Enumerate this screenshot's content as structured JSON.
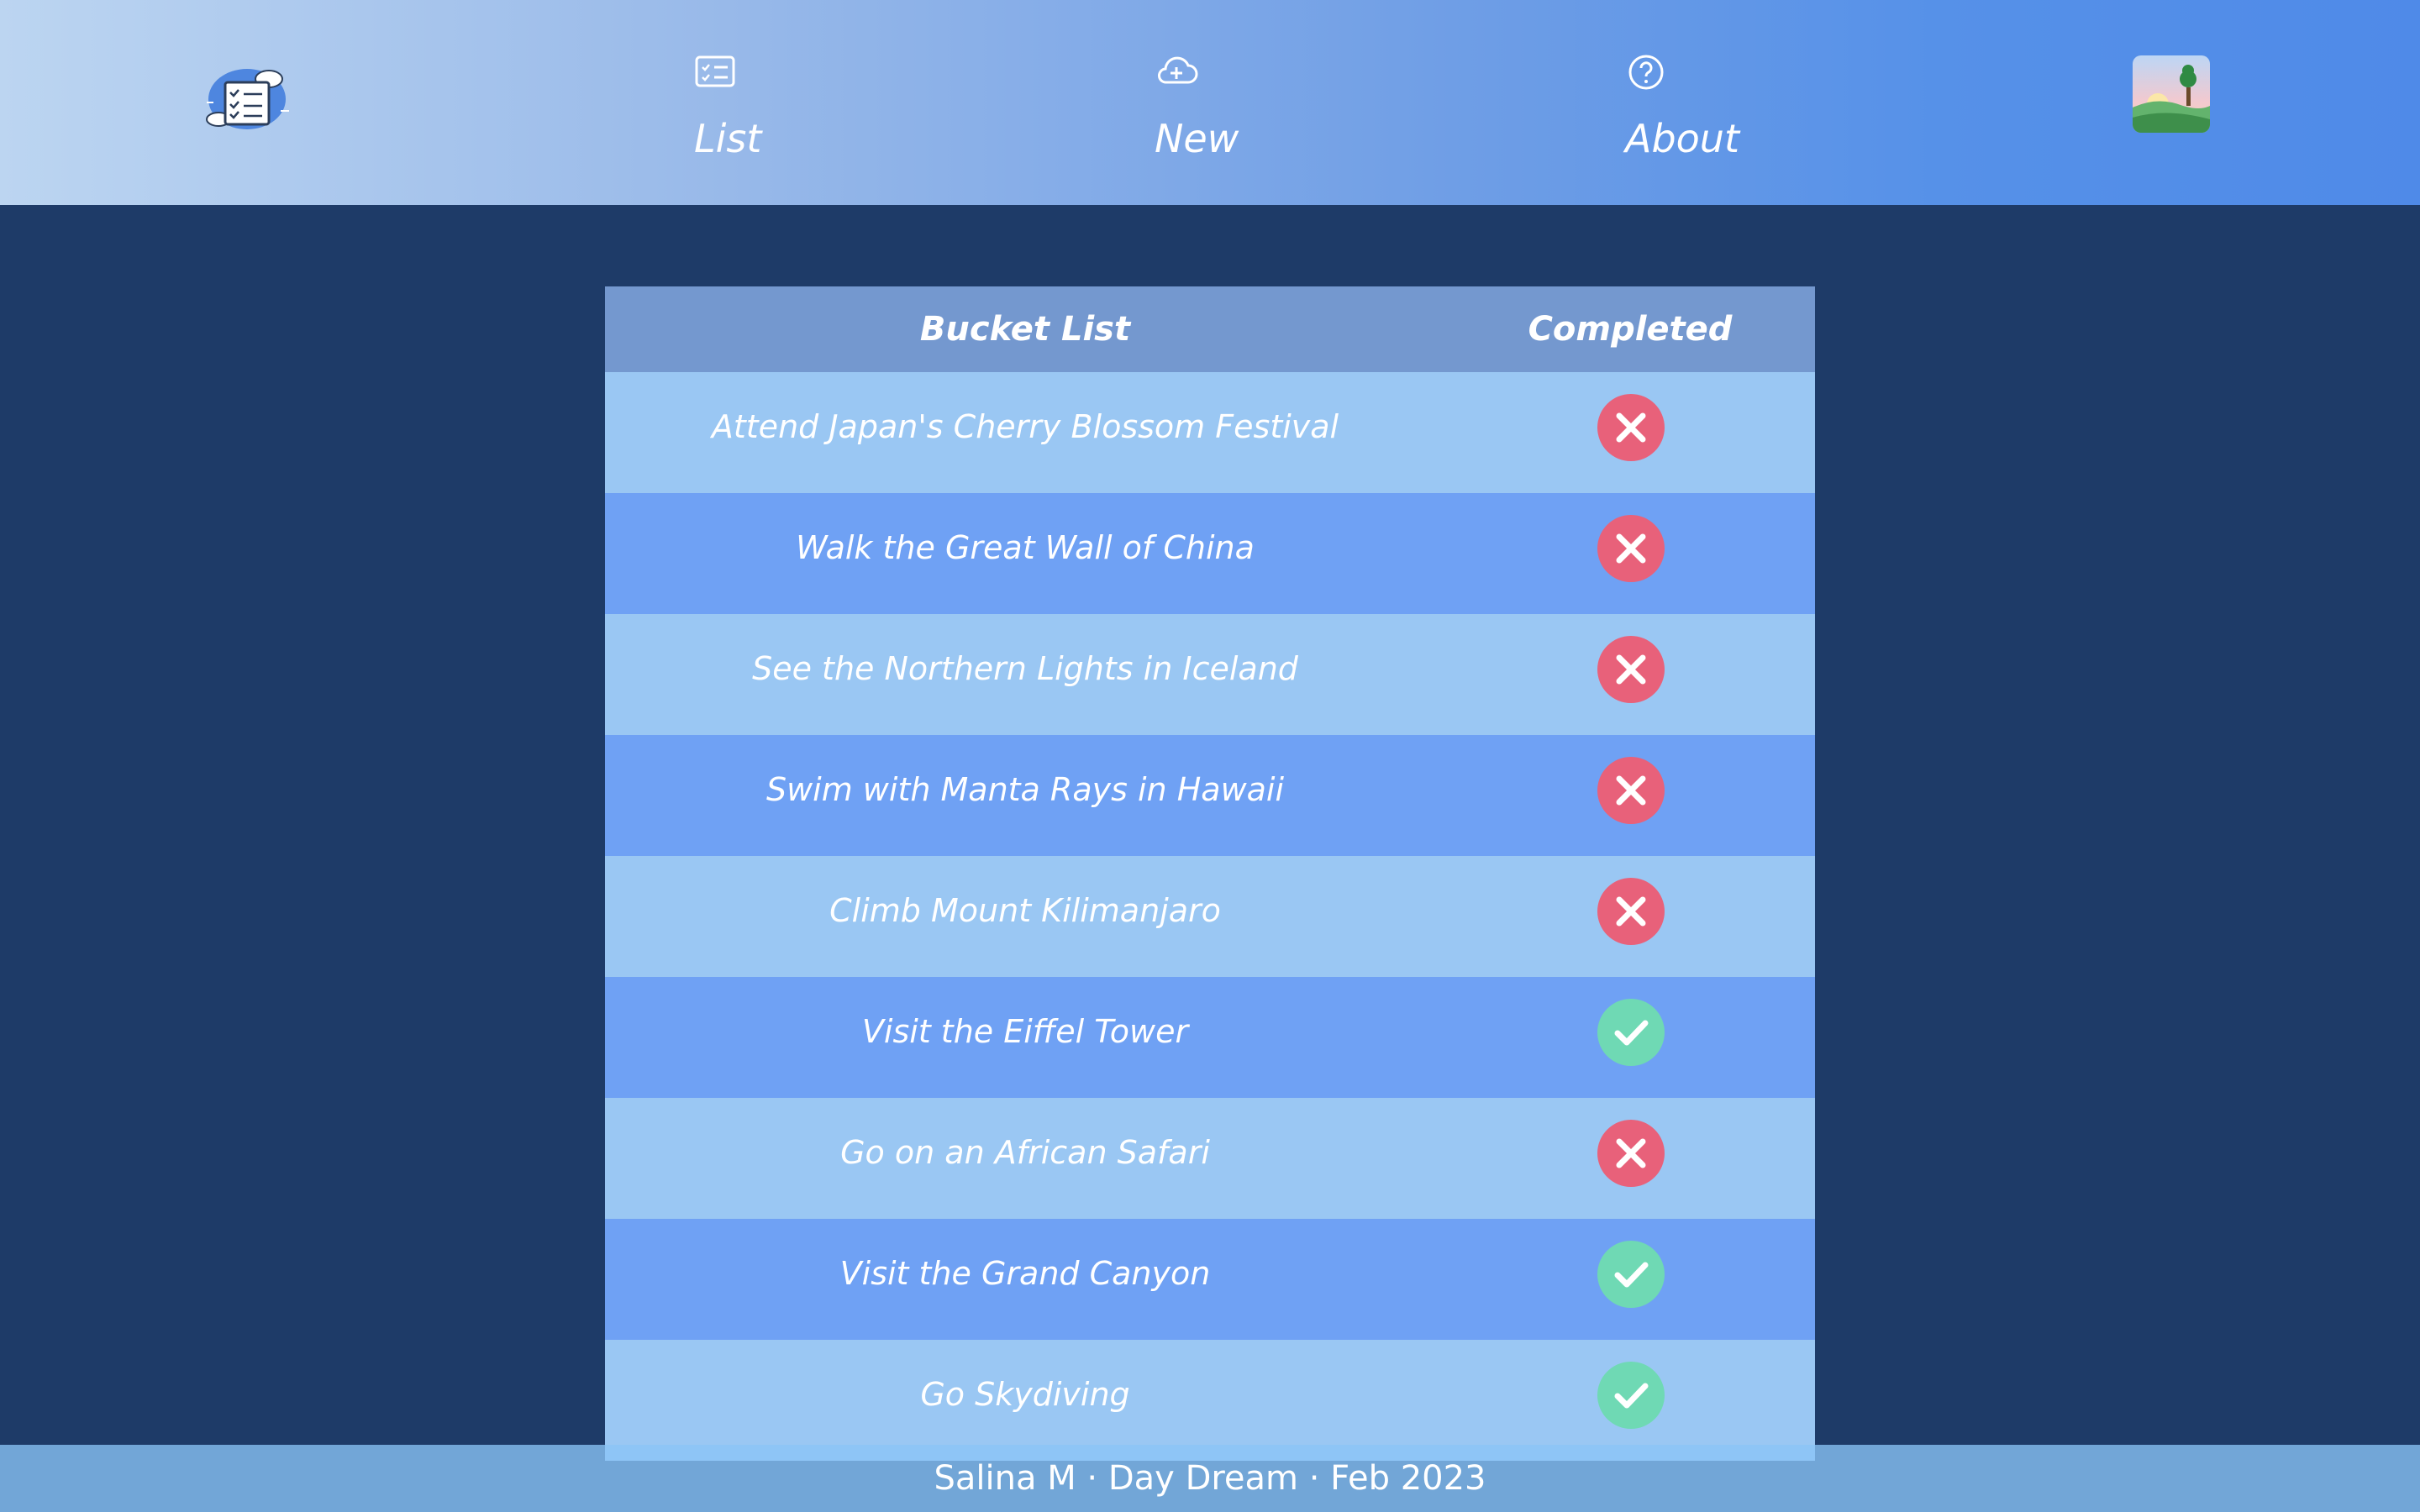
{
  "nav": {
    "items": [
      {
        "label": "List",
        "icon": "checklist-icon"
      },
      {
        "label": "New",
        "icon": "cloud-plus-icon"
      },
      {
        "label": "About",
        "icon": "question-circle-icon"
      }
    ],
    "logo_icon": "cloud-checklist-logo",
    "avatar_icon": "landscape-avatar-icon"
  },
  "table": {
    "headers": {
      "item": "Bucket List",
      "completed": "Completed"
    },
    "rows": [
      {
        "item": "Attend Japan's Cherry Blossom Festival",
        "completed": false
      },
      {
        "item": "Walk the Great Wall of China",
        "completed": false
      },
      {
        "item": "See the Northern Lights in Iceland",
        "completed": false
      },
      {
        "item": "Swim with Manta Rays in Hawaii",
        "completed": false
      },
      {
        "item": "Climb Mount Kilimanjaro",
        "completed": false
      },
      {
        "item": "Visit the Eiffel Tower",
        "completed": true
      },
      {
        "item": "Go on an African Safari",
        "completed": false
      },
      {
        "item": "Visit the Grand Canyon",
        "completed": true
      },
      {
        "item": "Go Skydiving",
        "completed": true
      }
    ]
  },
  "footer": {
    "text": "Salina M · Day Dream · Feb 2023"
  },
  "colors": {
    "background": "#1e3b68",
    "header_row": "#7498cf",
    "row_light": "#9ac7f3",
    "row_dark": "#6fa1f4",
    "incomplete": "#e8617a",
    "complete": "#6fd9b4"
  }
}
